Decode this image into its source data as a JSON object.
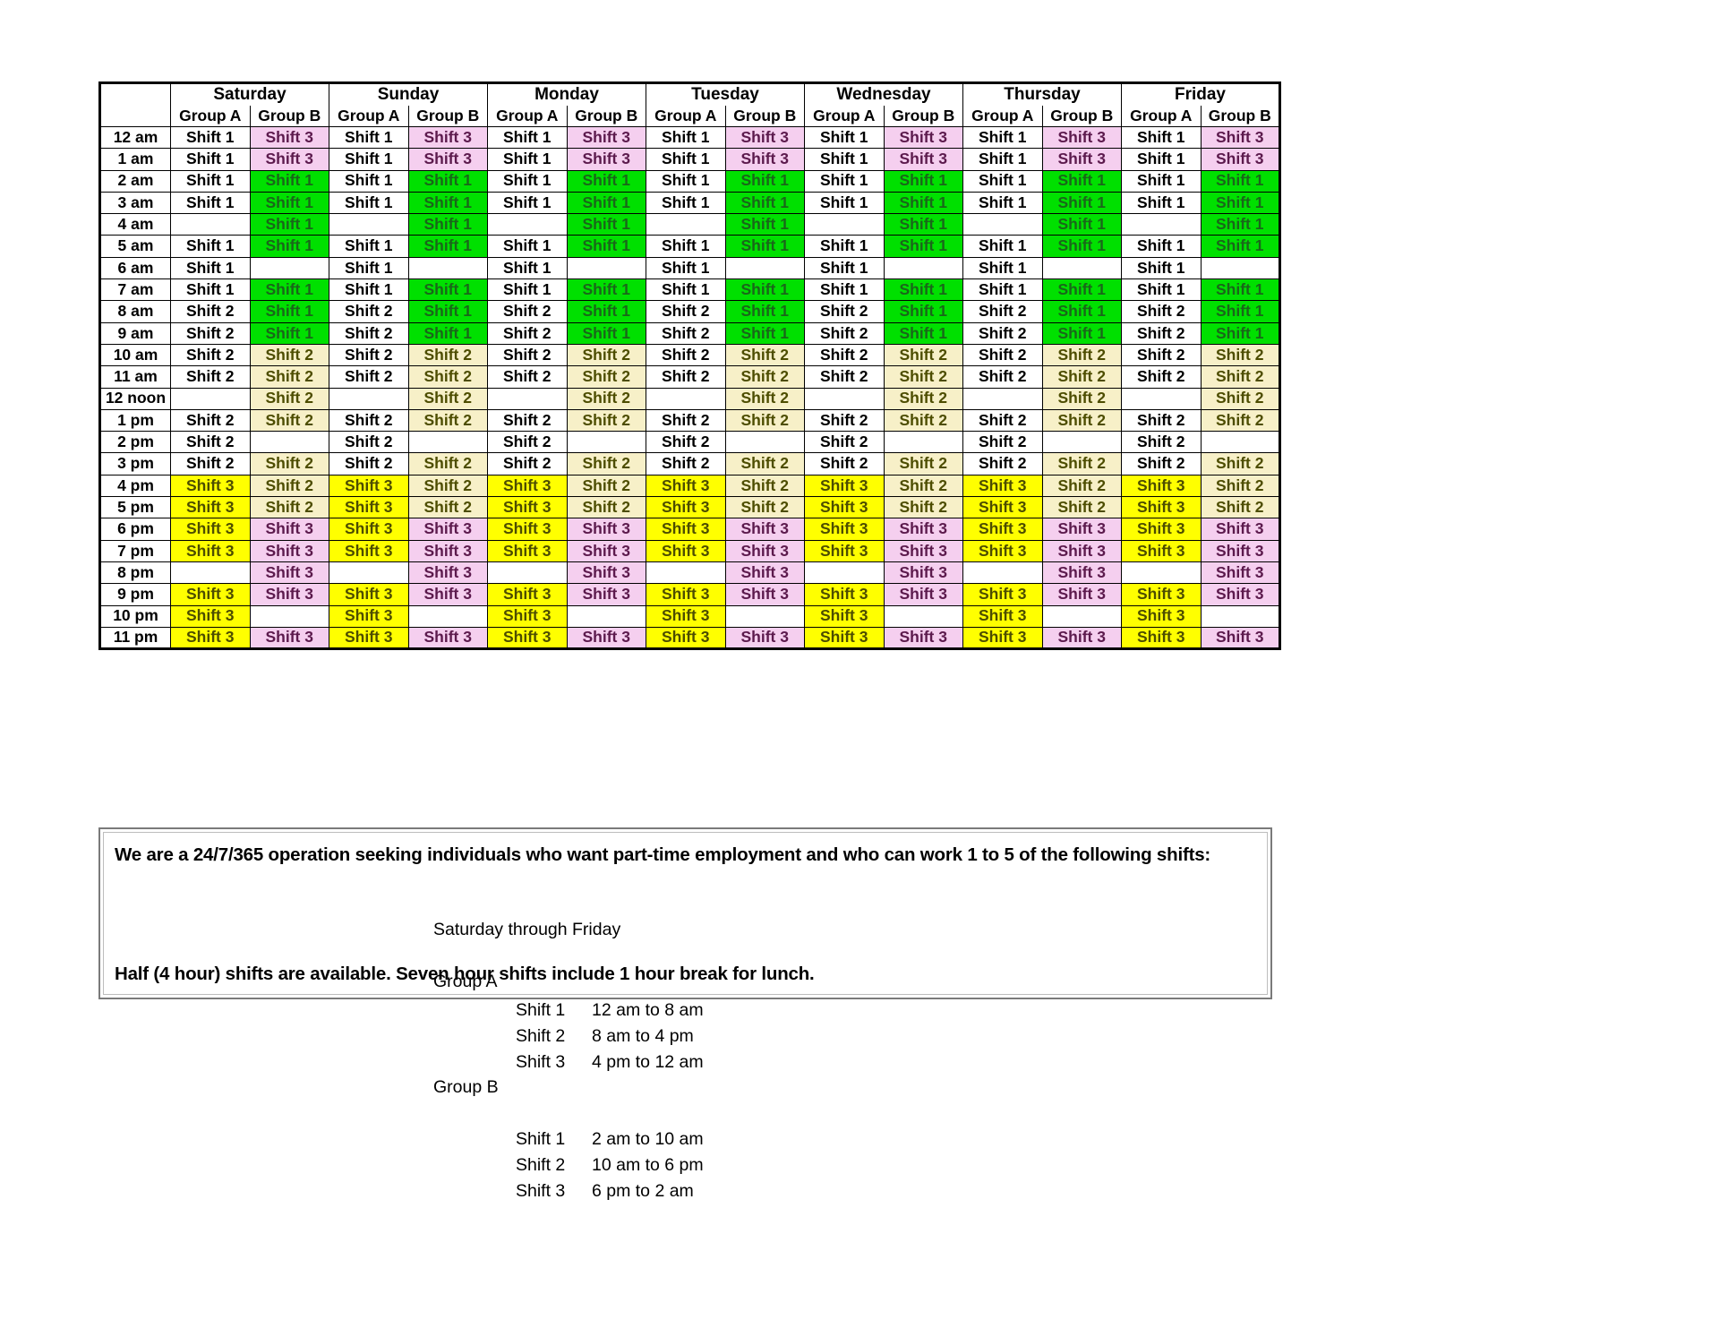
{
  "schedule": {
    "days": [
      "Saturday",
      "Sunday",
      "Monday",
      "Tuesday",
      "Wednesday",
      "Thursday",
      "Friday"
    ],
    "group_headers": [
      "Group A",
      "Group B"
    ],
    "time_label_header": "",
    "times": [
      "12 am",
      "1 am",
      "2 am",
      "3 am",
      "4 am",
      "5 am",
      "6 am",
      "7 am",
      "8 am",
      "9 am",
      "10 am",
      "11 am",
      "12 noon",
      "1 pm",
      "2 pm",
      "3 pm",
      "4 pm",
      "5 pm",
      "6 pm",
      "7 pm",
      "8 pm",
      "9 pm",
      "10 pm",
      "11 pm"
    ],
    "group_a_column": [
      "Shift 1",
      "Shift 1",
      "Shift 1",
      "Shift 1",
      "",
      "Shift 1",
      "Shift 1",
      "Shift 1",
      "Shift 2",
      "Shift 2",
      "Shift 2",
      "Shift 2",
      "",
      "Shift 2",
      "Shift 2",
      "Shift 2",
      "Shift 3",
      "Shift 3",
      "Shift 3",
      "Shift 3",
      "",
      "Shift 3",
      "Shift 3",
      "Shift 3"
    ],
    "group_b_column": [
      "Shift 3",
      "Shift 3",
      "Shift 1",
      "Shift 1",
      "Shift 1",
      "Shift 1",
      "",
      "Shift 1",
      "Shift 1",
      "Shift 1",
      "Shift 2",
      "Shift 2",
      "Shift 2",
      "Shift 2",
      "",
      "Shift 2",
      "Shift 2",
      "Shift 2",
      "Shift 3",
      "Shift 3",
      "Shift 3",
      "Shift 3",
      "",
      "Shift 3"
    ],
    "group_a_styles": [
      "s-a1",
      "s-a1",
      "s-a1",
      "s-a1",
      "s-empty",
      "s-a1",
      "s-a1",
      "s-a1",
      "s-a2",
      "s-a2",
      "s-a2",
      "s-a2",
      "s-empty",
      "s-a2",
      "s-a2",
      "s-a2",
      "s-a3",
      "s-a3",
      "s-a3",
      "s-a3",
      "s-empty",
      "s-a3",
      "s-a3",
      "s-a3"
    ],
    "group_b_styles": [
      "s-b3",
      "s-b3",
      "s-b1",
      "s-b1",
      "s-b1",
      "s-b1",
      "s-empty",
      "s-b1",
      "s-b1",
      "s-b1",
      "s-b2",
      "s-b2",
      "s-b2",
      "s-b2",
      "s-empty",
      "s-b2",
      "s-b2",
      "s-b2",
      "s-b3",
      "s-b3",
      "s-b3",
      "s-b3",
      "s-empty",
      "s-b3"
    ],
    "colors": {
      "group_a_shift3": "#ffff00",
      "group_b_shift1": "#00e000",
      "group_b_shift2": "#f7f0c8",
      "group_b_shift3": "#f5cfef",
      "plain": "#ffffff",
      "border": "#000000"
    }
  },
  "info": {
    "headline": "We are a 24/7/365 operation seeking individuals who want part-time employment and who can work 1 to 5 of the following shifts:",
    "week_span": "Saturday through Friday",
    "group_a": {
      "title": "Group A",
      "shifts": [
        {
          "label": "Shift 1",
          "hours": "12 am to 8 am"
        },
        {
          "label": "Shift 2",
          "hours": "8 am to 4 pm"
        },
        {
          "label": "Shift 3",
          "hours": "4 pm to 12 am"
        }
      ]
    },
    "group_b": {
      "title": "Group B",
      "shifts": [
        {
          "label": "Shift 1",
          "hours": "2 am to 10 am"
        },
        {
          "label": "Shift 2",
          "hours": "10 am to 6 pm"
        },
        {
          "label": "Shift 3",
          "hours": "6 pm to 2 am"
        }
      ]
    },
    "footer": "Half (4 hour) shifts are available.  Seven hour shifts include 1 hour break for lunch."
  }
}
